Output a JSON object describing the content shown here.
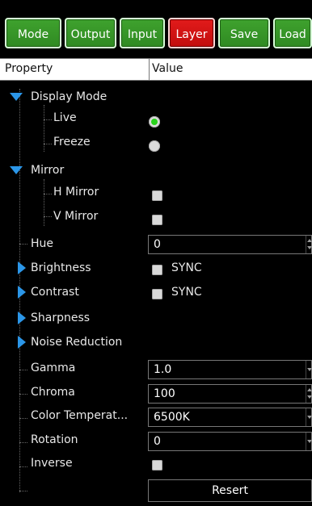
{
  "toolbar": {
    "buttons": [
      "Mode",
      "Output",
      "Input",
      "Layer",
      "Save",
      "Load"
    ],
    "active": "Layer"
  },
  "grid": {
    "col_property": "Property",
    "col_value": "Value"
  },
  "rows": {
    "display_mode": "Display Mode",
    "live": "Live",
    "freeze": "Freeze",
    "mirror": "Mirror",
    "h_mirror": "H Mirror",
    "v_mirror": "V Mirror",
    "hue": "Hue",
    "hue_value": "0",
    "brightness": "Brightness",
    "brightness_sync": "SYNC",
    "contrast": "Contrast",
    "contrast_sync": "SYNC",
    "sharpness": "Sharpness",
    "noise_reduction": "Noise Reduction",
    "gamma": "Gamma",
    "gamma_value": "1.0",
    "chroma": "Chroma",
    "chroma_value": "100",
    "color_temp": "Color Temperat...",
    "color_temp_value": "6500K",
    "rotation": "Rotation",
    "rotation_value": "0",
    "inverse": "Inverse",
    "reset_label": "Resert"
  },
  "colors": {
    "button_green": "#3fa22e",
    "button_active_red": "#e21b1b",
    "tree_accent_blue": "#2b96e8",
    "radio_selected_green": "#28d11b"
  },
  "state": {
    "display_mode_selected": "Live"
  }
}
